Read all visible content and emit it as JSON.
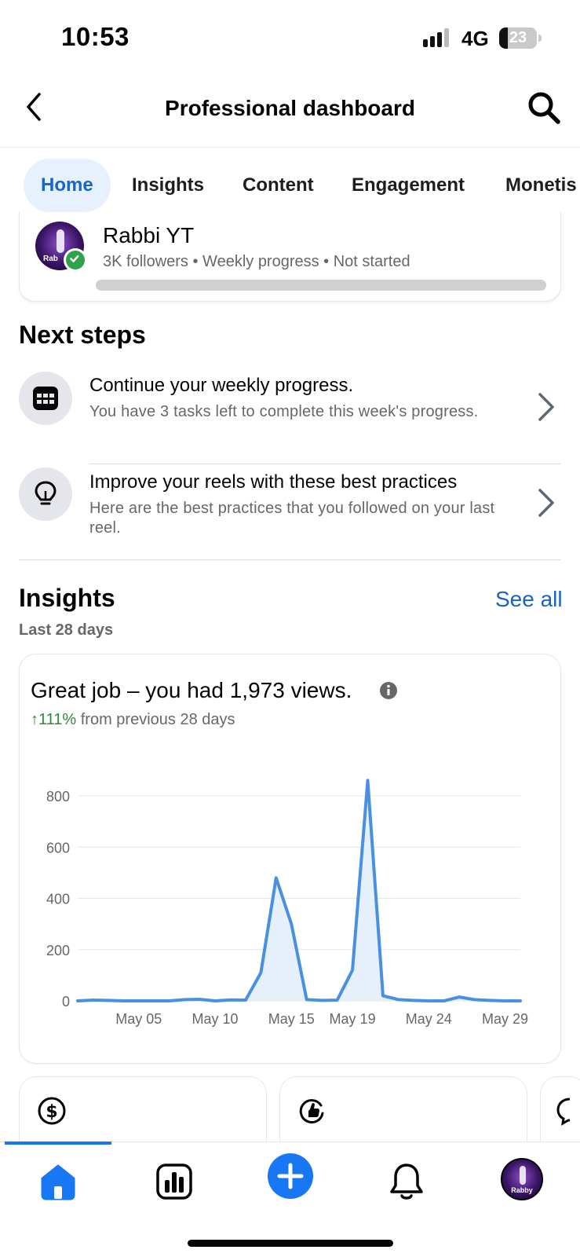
{
  "status_bar": {
    "time": "10:53",
    "network": "4G",
    "battery": "23",
    "battery_level": 0.23
  },
  "header": {
    "title": "Professional dashboard",
    "back_icon": "chevron-left-icon",
    "search_icon": "search-icon"
  },
  "tabs": [
    {
      "label": "Home",
      "active": true
    },
    {
      "label": "Insights",
      "active": false
    },
    {
      "label": "Content",
      "active": false
    },
    {
      "label": "Engagement",
      "active": false
    },
    {
      "label": "Monetis",
      "active": false
    }
  ],
  "profile": {
    "name": "Rabbi YT",
    "avatar_text": "Rab",
    "meta": "3K followers • Weekly progress • Not started",
    "weekly_progress": 0
  },
  "next_steps": {
    "title": "Next steps",
    "items": [
      {
        "icon": "calendar-grid-icon",
        "title": "Continue your weekly progress.",
        "description": "You have 3 tasks left to complete this week's progress."
      },
      {
        "icon": "lightbulb-icon",
        "title": "Improve your reels with these best practices",
        "description": "Here are the best practices that you followed on your last reel."
      }
    ]
  },
  "insights": {
    "title": "Insights",
    "see_all": "See all",
    "period": "Last 28 days",
    "headline": "Great job – you had 1,973 views.",
    "delta_value": "↑111%",
    "delta_text": " from previous 28 days"
  },
  "chart_data": {
    "type": "area",
    "ylim": [
      0,
      800
    ],
    "yticks": [
      "0",
      "200",
      "400",
      "600",
      "800"
    ],
    "xtick_labels": [
      "May 05",
      "May 10",
      "May 15",
      "May 19",
      "May 24",
      "May 29"
    ],
    "xtick_index": [
      4,
      9,
      14,
      18,
      23,
      28
    ],
    "x": [
      "May 01",
      "May 02",
      "May 03",
      "May 04",
      "May 05",
      "May 06",
      "May 07",
      "May 08",
      "May 09",
      "May 10",
      "May 11",
      "May 12",
      "May 13",
      "May 14",
      "May 15",
      "May 16",
      "May 17",
      "May 18",
      "May 19",
      "May 20",
      "May 21",
      "May 22",
      "May 23",
      "May 24",
      "May 25",
      "May 26",
      "May 27",
      "May 28",
      "May 29",
      "May 30"
    ],
    "values": [
      0,
      3,
      2,
      0,
      0,
      0,
      0,
      5,
      6,
      0,
      4,
      3,
      110,
      480,
      300,
      5,
      2,
      3,
      120,
      860,
      20,
      5,
      2,
      0,
      0,
      15,
      5,
      2,
      0,
      0
    ],
    "line_color": "#4a90e2",
    "fill_color": "#e5f0fb"
  },
  "bottom_nav": {
    "items": [
      "home-icon",
      "bar-chart-icon",
      "plus-icon",
      "bell-icon",
      "profile-avatar"
    ],
    "avatar_text": "Rabby",
    "accent": "#1877f2"
  }
}
